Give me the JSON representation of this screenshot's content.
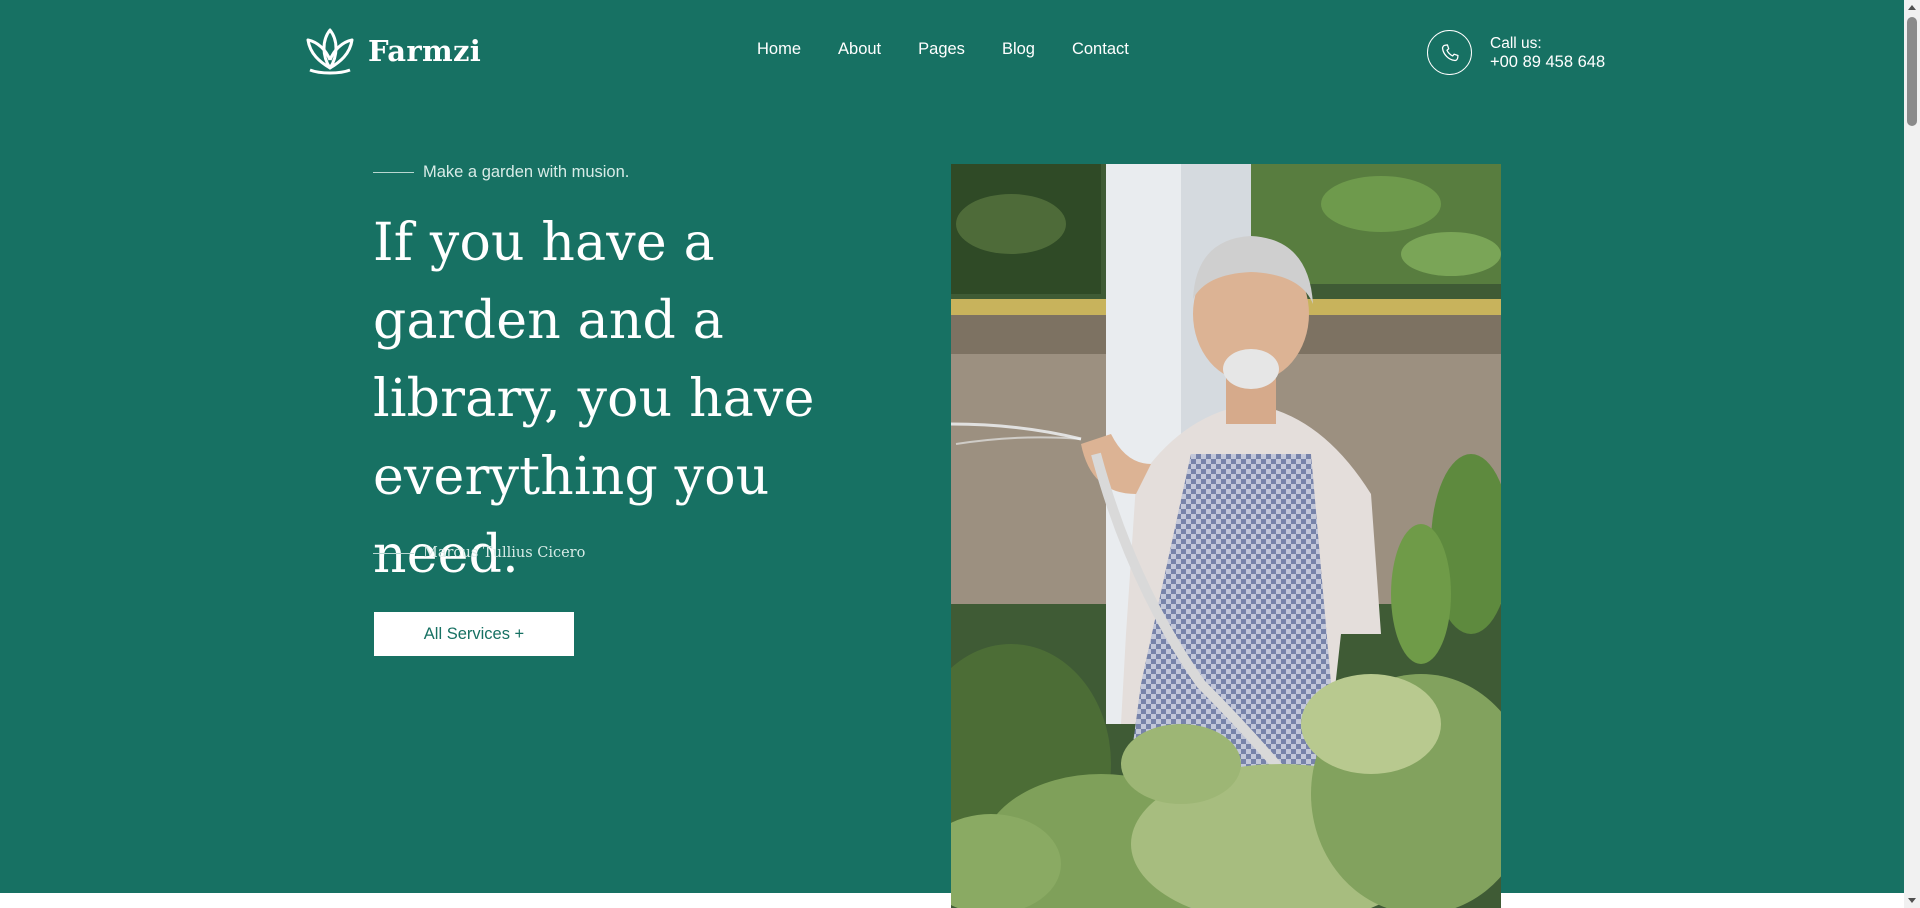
{
  "header": {
    "brand_name": "Farmzi",
    "logo_icon": "lotus-icon",
    "nav": [
      {
        "label": "Home"
      },
      {
        "label": "About"
      },
      {
        "label": "Pages"
      },
      {
        "label": "Blog"
      },
      {
        "label": "Contact"
      }
    ],
    "call": {
      "icon": "phone-icon",
      "label": "Call us:",
      "number": "+00 89 458 648"
    }
  },
  "hero": {
    "eyebrow": "Make a garden with musion.",
    "headline": "If you have a garden and a library, you have everything you need.",
    "author": "Marcus Tullius Cicero",
    "cta_label": "All Services +",
    "image_subject": "elderly man in checkered apron watering garden plants with a hose"
  },
  "colors": {
    "primary": "#177163",
    "text_on_primary": "#ffffff",
    "muted_on_primary": "#d8ebe7"
  }
}
